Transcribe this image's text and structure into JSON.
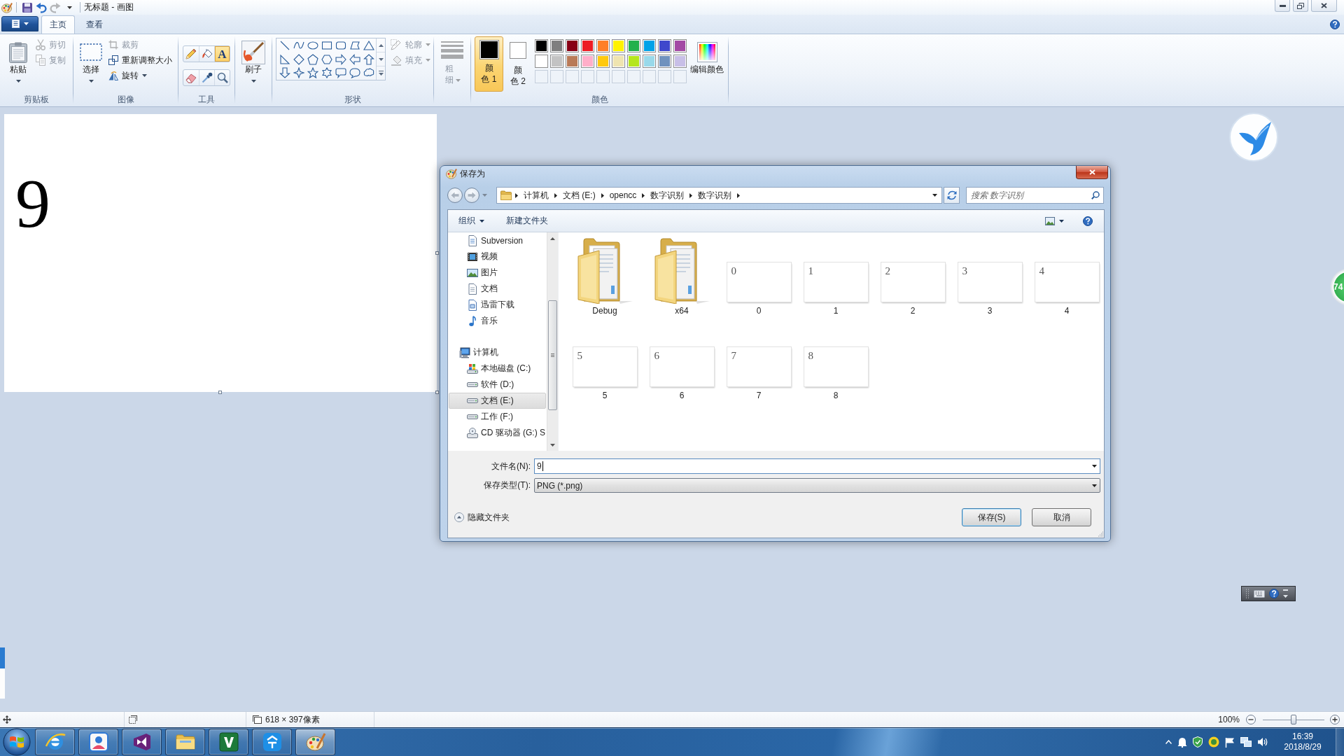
{
  "paint_window": {
    "title": "无标题 - 画图",
    "quick_access": [
      {
        "kind": "save",
        "disabled": false
      },
      {
        "kind": "undo",
        "disabled": false
      },
      {
        "kind": "redo",
        "disabled": true
      },
      {
        "kind": "customize",
        "disabled": false
      }
    ]
  },
  "ribbon": {
    "tabs": [
      {
        "label": "主页",
        "selected": true
      },
      {
        "label": "查看",
        "selected": false
      }
    ],
    "clipboard": {
      "label": "剪贴板",
      "paste": {
        "label": "粘贴",
        "disabled": false
      },
      "cut": {
        "label": "剪切",
        "disabled": true
      },
      "copy": {
        "label": "复制",
        "disabled": true
      }
    },
    "image": {
      "label": "图像",
      "select": {
        "label": "选择",
        "disabled": false
      },
      "crop": {
        "label": "裁剪",
        "disabled": true
      },
      "resize": {
        "label": "重新调整大小",
        "disabled": false
      },
      "rotate": {
        "label": "旋转",
        "disabled": false
      }
    },
    "tools": {
      "label": "工具",
      "items": [
        {
          "kind": "pencil",
          "selected": false
        },
        {
          "kind": "fill",
          "selected": false
        },
        {
          "kind": "text",
          "glyph": "A",
          "selected": true
        },
        {
          "kind": "eraser",
          "selected": false
        },
        {
          "kind": "picker",
          "selected": false
        },
        {
          "kind": "magnifier",
          "selected": false
        }
      ]
    },
    "brushes": {
      "label": "刷子"
    },
    "shapes": {
      "label": "形状",
      "outline": {
        "label": "轮廓",
        "disabled": true
      },
      "fill": {
        "label": "填充",
        "disabled": true
      }
    },
    "size": {
      "label": "粗细",
      "disabled": true
    },
    "colors": {
      "label": "颜色",
      "color1": {
        "label": "颜色 1",
        "color": "#000000",
        "selected": true
      },
      "color2": {
        "label": "颜色 2",
        "color": "#ffffff",
        "selected": false
      },
      "palette": [
        {
          "kind": "color",
          "color": "#000000"
        },
        {
          "kind": "color",
          "color": "#7f7f7f"
        },
        {
          "kind": "color",
          "color": "#880015"
        },
        {
          "kind": "color",
          "color": "#ed1c24"
        },
        {
          "kind": "color",
          "color": "#ff7f27"
        },
        {
          "kind": "color",
          "color": "#fff200"
        },
        {
          "kind": "color",
          "color": "#22b14c"
        },
        {
          "kind": "color",
          "color": "#00a2e8"
        },
        {
          "kind": "color",
          "color": "#3f48cc"
        },
        {
          "kind": "color",
          "color": "#a349a4"
        },
        {
          "kind": "color",
          "color": "#ffffff"
        },
        {
          "kind": "color",
          "color": "#c3c3c3"
        },
        {
          "kind": "color",
          "color": "#b97a57"
        },
        {
          "kind": "color",
          "color": "#ffaec9"
        },
        {
          "kind": "color",
          "color": "#ffc90e"
        },
        {
          "kind": "color",
          "color": "#efe4b0"
        },
        {
          "kind": "color",
          "color": "#b5e61d"
        },
        {
          "kind": "color",
          "color": "#99d9ea"
        },
        {
          "kind": "color",
          "color": "#7092be"
        },
        {
          "kind": "color",
          "color": "#c8bfe7"
        },
        {
          "kind": "empty"
        },
        {
          "kind": "empty"
        },
        {
          "kind": "empty"
        },
        {
          "kind": "empty"
        },
        {
          "kind": "empty"
        },
        {
          "kind": "empty"
        },
        {
          "kind": "empty"
        },
        {
          "kind": "empty"
        },
        {
          "kind": "empty"
        },
        {
          "kind": "empty"
        }
      ],
      "edit": {
        "label": "编辑颜色"
      }
    }
  },
  "canvas": {
    "text": "9"
  },
  "floating_widget": {
    "text": "74"
  },
  "save_dialog": {
    "title": "保存为",
    "back": {
      "disabled": true
    },
    "forward": {
      "disabled": true
    },
    "breadcrumb": [
      "计算机",
      "文档 (E:)",
      "opencc",
      "数字识别",
      "数字识别"
    ],
    "search": {
      "placeholder": "搜索 数字识别"
    },
    "toolbar": {
      "organize": "组织",
      "new_folder": "新建文件夹"
    },
    "nav_tree": [
      {
        "children": [
          {
            "kind": "svn",
            "label": "Subversion",
            "selected": false
          },
          {
            "kind": "video",
            "label": "视频",
            "selected": false
          },
          {
            "kind": "picture",
            "label": "图片",
            "selected": false
          },
          {
            "kind": "document",
            "label": "文档",
            "selected": false
          },
          {
            "kind": "download",
            "label": "迅雷下载",
            "selected": false
          },
          {
            "kind": "music",
            "label": "音乐",
            "selected": false
          }
        ]
      },
      {
        "kind": "computer",
        "label": "计算机",
        "selected": false,
        "children": [
          {
            "kind": "system_drive",
            "label": "本地磁盘 (C:)",
            "selected": false
          },
          {
            "kind": "drive",
            "label": "软件 (D:)",
            "selected": false
          },
          {
            "kind": "drive",
            "label": "文档 (E:)",
            "selected": true
          },
          {
            "kind": "drive",
            "label": "工作 (F:)",
            "selected": false
          },
          {
            "kind": "cd_drive",
            "label": "CD 驱动器 (G:) S",
            "selected": false
          }
        ]
      }
    ],
    "items": [
      {
        "kind": "folder",
        "label": "Debug"
      },
      {
        "kind": "folder",
        "label": "x64"
      },
      {
        "kind": "image",
        "label": "0",
        "preview": "0"
      },
      {
        "kind": "image",
        "label": "1",
        "preview": "1"
      },
      {
        "kind": "image",
        "label": "2",
        "preview": "2"
      },
      {
        "kind": "image",
        "label": "3",
        "preview": "3"
      },
      {
        "kind": "image",
        "label": "4",
        "preview": "4"
      },
      {
        "kind": "image",
        "label": "5",
        "preview": "5"
      },
      {
        "kind": "image",
        "label": "6",
        "preview": "6"
      },
      {
        "kind": "image",
        "label": "7",
        "preview": "7"
      },
      {
        "kind": "image",
        "label": "8",
        "preview": "8"
      }
    ],
    "filename": {
      "label": "文件名(N):",
      "value": "9"
    },
    "filetype": {
      "label": "保存类型(T):",
      "value": "PNG (*.png)"
    },
    "hide_folders": {
      "label": "隐藏文件夹"
    },
    "buttons": [
      {
        "label": "保存(S)",
        "kind": "default"
      },
      {
        "label": "取消",
        "kind": "normal"
      }
    ]
  },
  "status_bar": {
    "size": "618 × 397像素",
    "zoom": "100%",
    "zoom_slider": {
      "level": 0.5
    }
  },
  "taskbar": {
    "apps": [
      {
        "kind": "browser",
        "selected": false
      },
      {
        "kind": "contacts",
        "selected": false
      },
      {
        "kind": "ide",
        "selected": false
      },
      {
        "kind": "files",
        "selected": false
      },
      {
        "kind": "editor",
        "selected": false
      },
      {
        "kind": "messenger",
        "selected": false
      },
      {
        "kind": "paint",
        "selected": true
      }
    ],
    "clock": {
      "time": "16:39",
      "date": "2018/8/29"
    }
  }
}
